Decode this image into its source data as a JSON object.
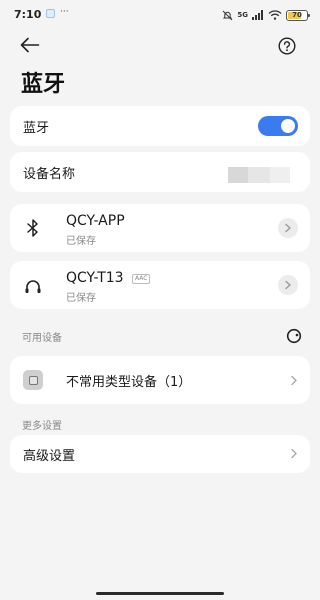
{
  "status_bar": {
    "time": "7:10",
    "dots": "···",
    "network": "5G",
    "battery_text": "70",
    "battery_level": 0.7,
    "battery_color": "#f2c84b"
  },
  "header": {
    "title": "蓝牙",
    "back_icon": "arrow-left-icon",
    "help_icon": "question-circle-icon"
  },
  "bluetooth_toggle": {
    "label": "蓝牙",
    "enabled": true,
    "accent_color": "#3a7bef"
  },
  "device_name": {
    "label": "设备名称"
  },
  "paired_devices": [
    {
      "name": "QCY-APP",
      "status": "已保存",
      "icon": "bluetooth-icon"
    },
    {
      "name": "QCY-T13",
      "status": "已保存",
      "codec": "AAC",
      "icon": "headphones-icon"
    }
  ],
  "available_section": {
    "label": "可用设备",
    "item_label": "不常用类型设备（1）"
  },
  "more_section": {
    "label": "更多设置",
    "item_label": "高级设置"
  }
}
